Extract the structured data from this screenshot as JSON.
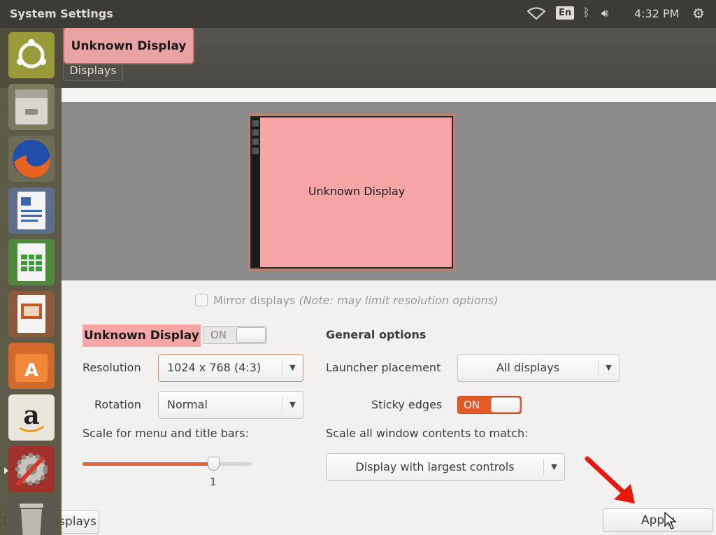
{
  "top_panel": {
    "title": "System Settings",
    "keyboard_layout": "En",
    "clock": "4:32 PM"
  },
  "toolbar": {
    "all_settings_label": "splays",
    "breadcrumb": "Displays",
    "tooltip": "Unknown Display"
  },
  "preview": {
    "monitor_label": "Unknown Display"
  },
  "mirror": {
    "label": "Mirror displays",
    "note": "(Note: may limit resolution options)",
    "checked": false
  },
  "display_settings": {
    "name": "Unknown Display",
    "toggle": "ON",
    "resolution_label": "Resolution",
    "resolution_value": "1024 x 768 (4:3)",
    "rotation_label": "Rotation",
    "rotation_value": "Normal",
    "scale_label": "Scale for menu and title bars:",
    "scale_value": "1"
  },
  "general_options": {
    "heading": "General options",
    "launcher_label": "Launcher placement",
    "launcher_value": "All displays",
    "sticky_label": "Sticky edges",
    "sticky_toggle": "ON",
    "scale_all_label": "Scale all window contents to match:",
    "scale_all_value": "Display with largest controls"
  },
  "buttons": {
    "detect": "Detect Displays",
    "apply": "Apply"
  },
  "colors": {
    "accent": "#e45a27",
    "highlight": "#f7a5a5"
  },
  "launcher": {
    "icons": [
      "ubuntu-icon",
      "file-manager-icon",
      "firefox-icon",
      "writer-icon",
      "calc-icon",
      "impress-icon",
      "software-center-icon",
      "amazon-icon",
      "system-settings-icon",
      "trash-icon"
    ]
  }
}
